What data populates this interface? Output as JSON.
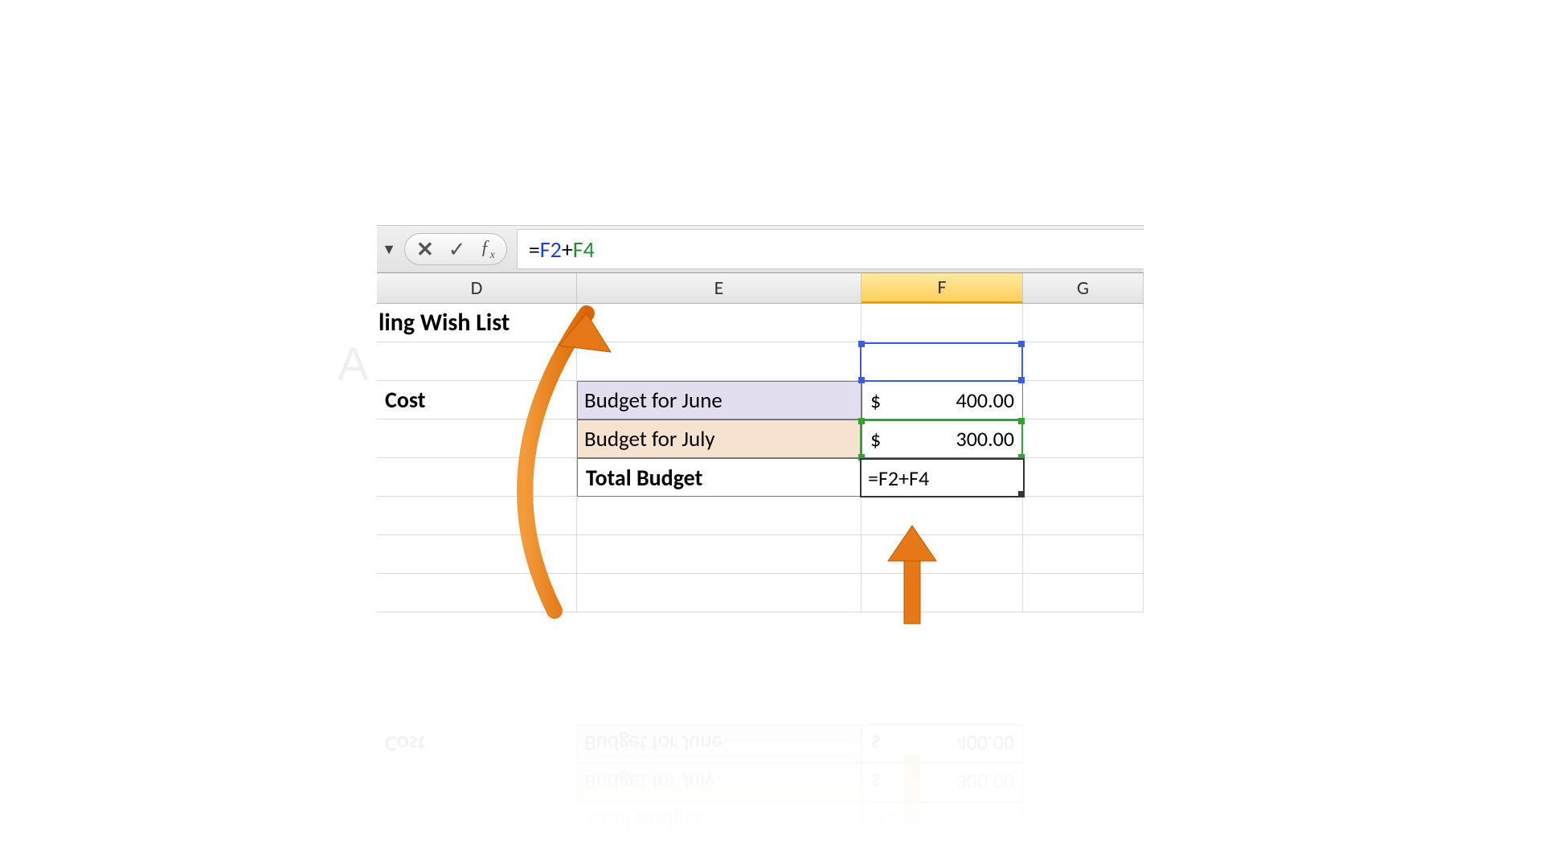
{
  "formula_bar": {
    "eq": "=",
    "ref1": "F2",
    "plus": "+",
    "ref2": "F4"
  },
  "columns": {
    "d": "D",
    "e": "E",
    "f": "F",
    "g": "G"
  },
  "cells": {
    "title": "ling Wish List",
    "cost": "Cost",
    "budget_june": "Budget for June",
    "budget_july": "Budget for July",
    "total_budget": "Total Budget",
    "val_june_sym": "$",
    "val_june": "400.00",
    "val_july_sym": "$",
    "val_july": "300.00",
    "edit_formula": "=F2+F4"
  },
  "watermark": "ATRO ACADEMY",
  "colors": {
    "ref_blue": "#3b5fe0",
    "ref_green": "#2da62d",
    "header_selected": "#ffcf5a",
    "arrow": "#e77817"
  },
  "icons": {
    "dropdown": "▼",
    "cancel": "✕",
    "enter": "✓",
    "fx": "fx"
  }
}
